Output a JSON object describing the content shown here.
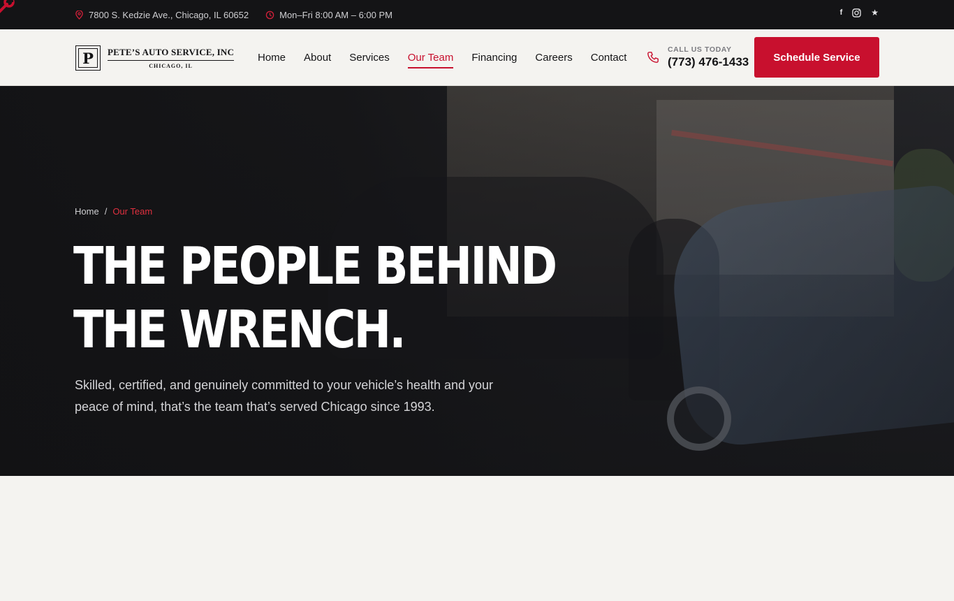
{
  "topbar": {
    "address": "7800 S. Kedzie Ave., Chicago, IL 60652",
    "hours": "Mon–Fri 8:00 AM – 6:00 PM",
    "social": [
      {
        "icon": "facebook-icon",
        "glyph": "f"
      },
      {
        "icon": "instagram-icon",
        "glyph": ""
      },
      {
        "icon": "star-icon",
        "glyph": "★"
      }
    ]
  },
  "logo": {
    "mark": "P",
    "name": "PETE’S AUTO SERVICE, INC",
    "city": "CHICAGO, IL"
  },
  "nav": {
    "items": [
      "Home",
      "About",
      "Services",
      "Our Team",
      "Financing",
      "Careers",
      "Contact"
    ],
    "active": "Our Team"
  },
  "call": {
    "label": "CALL US TODAY",
    "number": "(773) 476-1433"
  },
  "cta": {
    "label": "Schedule Service"
  },
  "hero": {
    "breadcrumb": {
      "home": "Home",
      "separator": "/",
      "current": "Our Team"
    },
    "title_line1": "THE PEOPLE BEHIND",
    "title_line2": "THE WRENCH.",
    "subtitle": "Skilled, certified, and genuinely committed to your vehicle’s health and your peace of mind, that’s the team that’s served Chicago since 1993."
  },
  "colors": {
    "accent": "#c8102e",
    "dark": "#141416",
    "background": "#f4f3f0"
  }
}
